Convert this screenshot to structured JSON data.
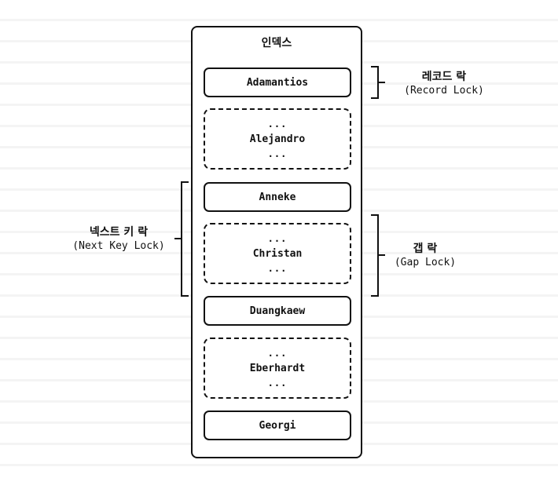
{
  "diagram": {
    "title": "인덱스",
    "items": [
      {
        "kind": "record",
        "text": "Adamantios"
      },
      {
        "kind": "gap",
        "text": "Alejandro",
        "dots": "..."
      },
      {
        "kind": "record",
        "text": "Anneke"
      },
      {
        "kind": "gap",
        "text": "Christan",
        "dots": "..."
      },
      {
        "kind": "record",
        "text": "Duangkaew"
      },
      {
        "kind": "gap",
        "text": "Eberhardt",
        "dots": "..."
      },
      {
        "kind": "record",
        "text": "Georgi"
      }
    ],
    "labels": {
      "record_lock": {
        "ko": "레코드 락",
        "en": "(Record Lock)"
      },
      "gap_lock": {
        "ko": "갭 락",
        "en": "(Gap Lock)"
      },
      "next_key_lock": {
        "ko": "넥스트 키 락",
        "en": "(Next Key Lock)"
      }
    }
  }
}
